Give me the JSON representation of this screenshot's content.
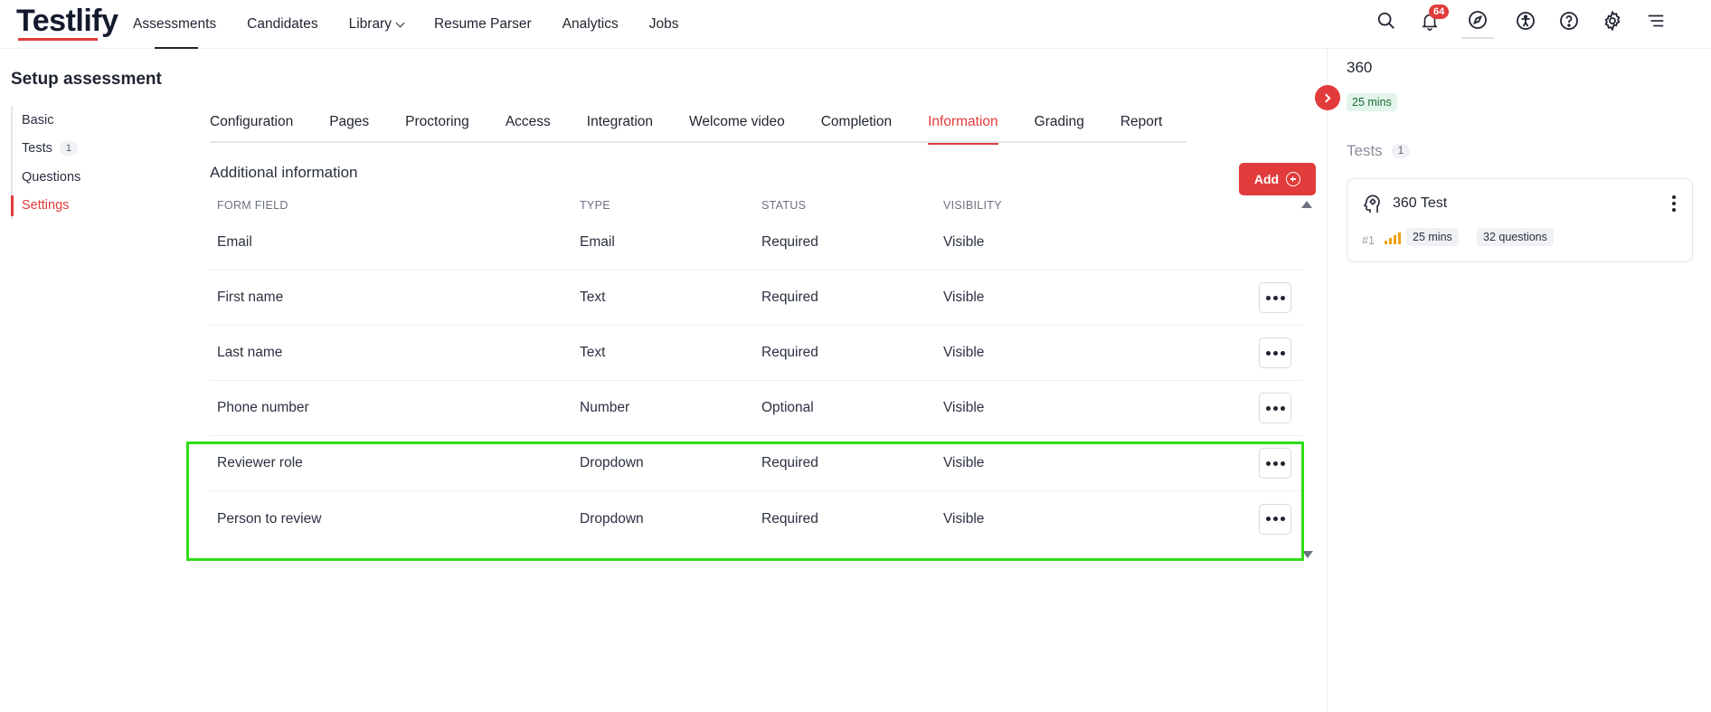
{
  "app": {
    "logo": "Testlify"
  },
  "nav": {
    "items": [
      {
        "label": "Assessments",
        "active": true
      },
      {
        "label": "Candidates"
      },
      {
        "label": "Library",
        "dropdown": true
      },
      {
        "label": "Resume Parser"
      },
      {
        "label": "Analytics"
      },
      {
        "label": "Jobs"
      }
    ],
    "notification_count": "64",
    "icons": [
      "search-icon",
      "bell-icon",
      "compass-icon",
      "accessibility-icon",
      "help-icon",
      "gear-icon",
      "menu-icon"
    ]
  },
  "sidebar": {
    "title": "Setup assessment",
    "items": [
      {
        "label": "Basic"
      },
      {
        "label": "Tests",
        "count": "1"
      },
      {
        "label": "Questions"
      },
      {
        "label": "Settings",
        "active": true
      }
    ]
  },
  "tabs": [
    {
      "label": "Configuration"
    },
    {
      "label": "Pages"
    },
    {
      "label": "Proctoring"
    },
    {
      "label": "Access"
    },
    {
      "label": "Integration"
    },
    {
      "label": "Welcome video"
    },
    {
      "label": "Completion"
    },
    {
      "label": "Information",
      "active": true
    },
    {
      "label": "Grading"
    },
    {
      "label": "Report"
    }
  ],
  "section": {
    "title": "Additional information",
    "add_label": "Add"
  },
  "table": {
    "headers": [
      "FORM FIELD",
      "TYPE",
      "STATUS",
      "VISIBILITY"
    ],
    "rows": [
      {
        "field": "Email",
        "type": "Email",
        "status": "Required",
        "visibility": "Visible",
        "menu": false
      },
      {
        "field": "First name",
        "type": "Text",
        "status": "Required",
        "visibility": "Visible",
        "menu": true
      },
      {
        "field": "Last name",
        "type": "Text",
        "status": "Required",
        "visibility": "Visible",
        "menu": true
      },
      {
        "field": "Phone number",
        "type": "Number",
        "status": "Optional",
        "visibility": "Visible",
        "menu": true
      },
      {
        "field": "Reviewer role",
        "type": "Dropdown",
        "status": "Required",
        "visibility": "Visible",
        "menu": true
      },
      {
        "field": "Person to review",
        "type": "Dropdown",
        "status": "Required",
        "visibility": "Visible",
        "menu": true
      }
    ]
  },
  "right_panel": {
    "title": "360",
    "duration": "25 mins",
    "tests_label": "Tests",
    "tests_count": "1",
    "test": {
      "name": "360 Test",
      "number": "#1",
      "duration": "25 mins",
      "questions": "32 questions"
    }
  },
  "colors": {
    "accent": "#e23b3b",
    "highlight": "#2ede16",
    "success_bg": "#e3f5ea",
    "difficulty": "#f0a010"
  }
}
